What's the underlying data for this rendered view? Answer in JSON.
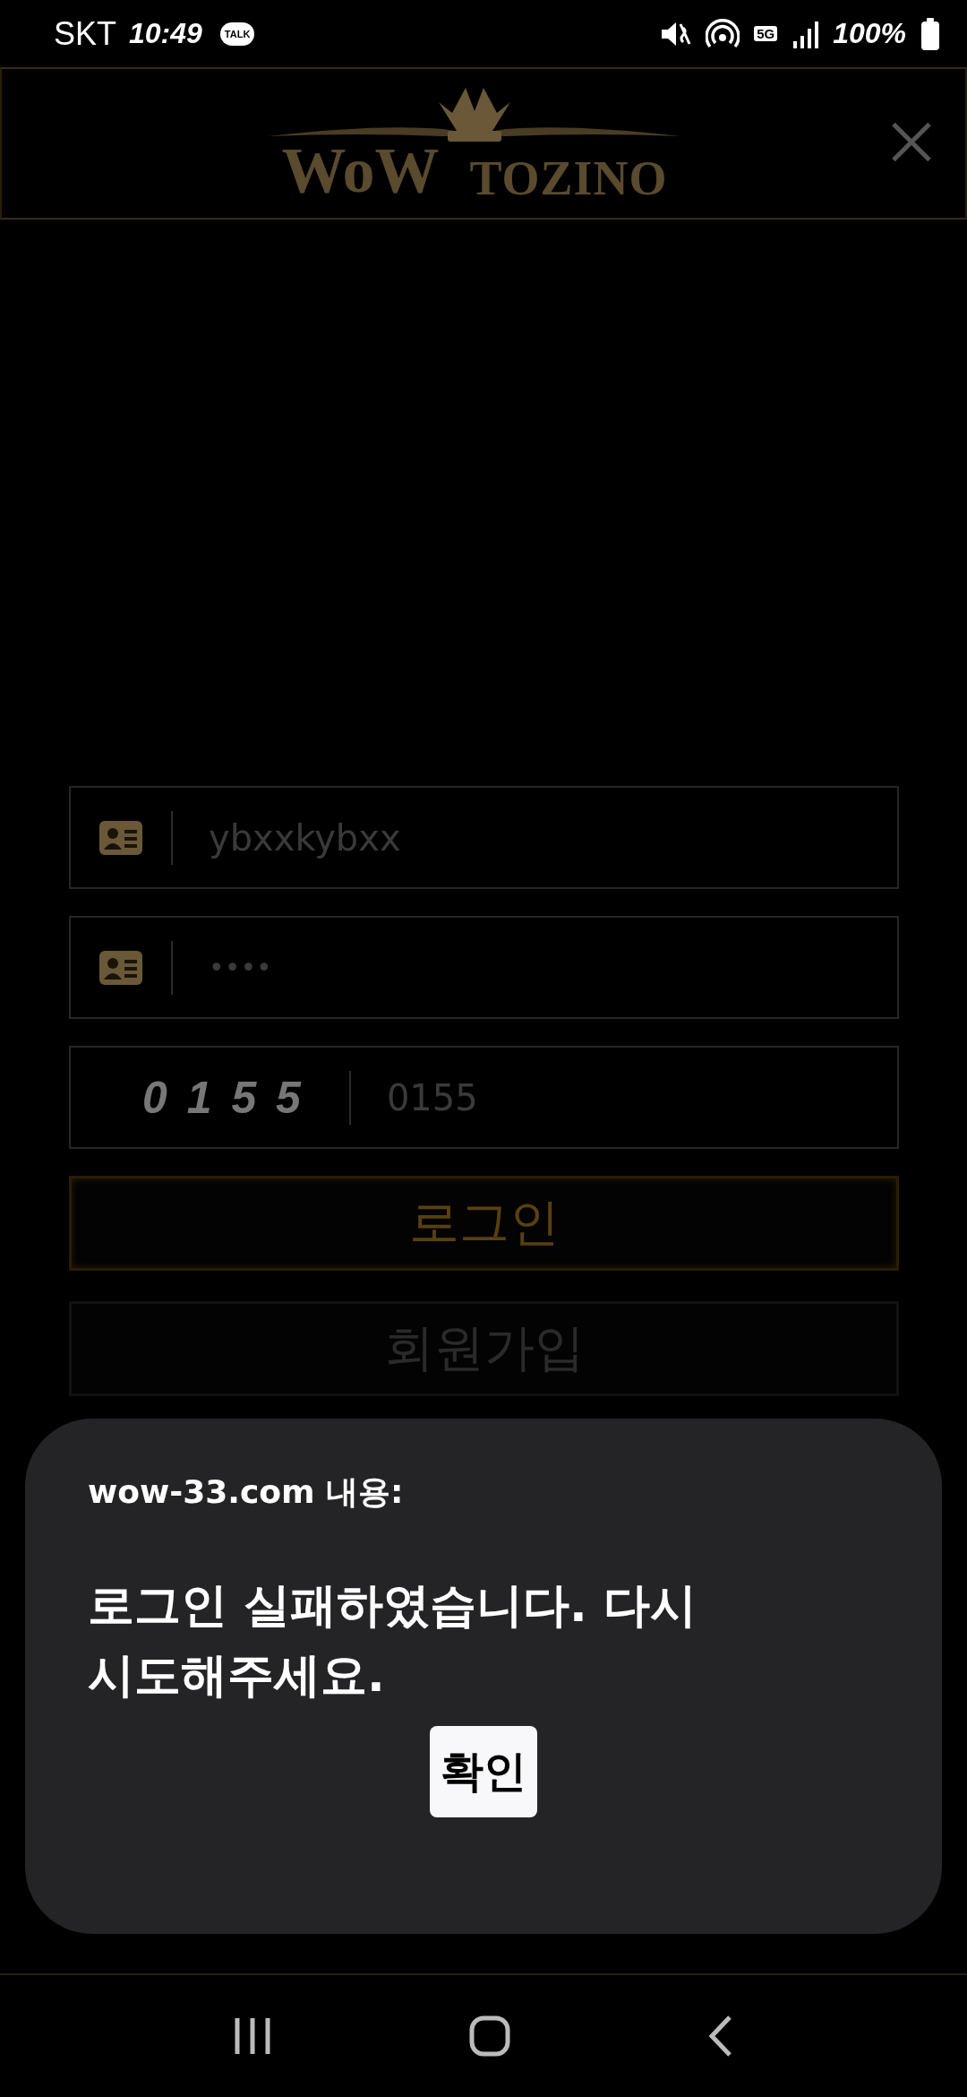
{
  "status_bar": {
    "carrier": "SKT",
    "time": "10:49",
    "chat_badge": "TALK",
    "network": "5G",
    "battery": "100%"
  },
  "header": {
    "logo_left": "WoW",
    "logo_right": "TOZINO"
  },
  "form": {
    "fields": [
      {
        "kind": "username",
        "value": "ybxxkybxx"
      },
      {
        "kind": "password",
        "value": "••••"
      },
      {
        "kind": "captcha",
        "code": "0 1 5 5",
        "value": "0155"
      }
    ],
    "buttons": [
      {
        "kind": "primary",
        "label": "로그인"
      },
      {
        "kind": "secondary",
        "label": "회원가입"
      }
    ]
  },
  "dialog": {
    "title": "wow-33.com 내용:",
    "message": "로그인 실패하였습니다. 다시 시도해주세요.",
    "button": "확인"
  }
}
